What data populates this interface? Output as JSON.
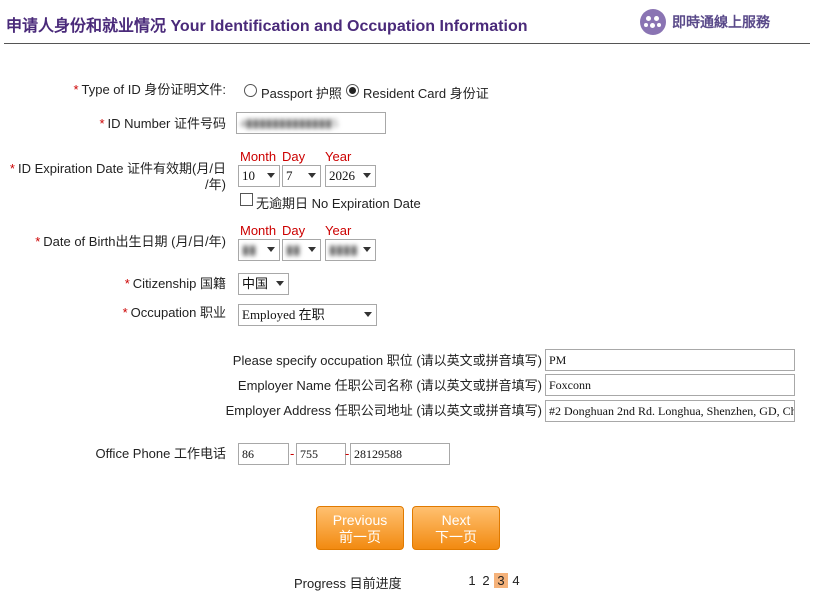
{
  "header": {
    "title": "申请人身份和就业情况 Your Identification and Occupation Information",
    "live_service": "即時通線上服務",
    "icon": "chat-bubble-icon"
  },
  "form": {
    "required_mark": "*",
    "id_type": {
      "label": "Type of ID 身份证明文件:",
      "options": [
        {
          "label": "Passport 护照",
          "selected": false
        },
        {
          "label": "Resident Card 身份证",
          "selected": true
        }
      ]
    },
    "id_number": {
      "label": "ID Number 证件号码",
      "value": "4▮▮▮▮▮▮▮▮▮▮▮▮▮5"
    },
    "expiration": {
      "label_line1": "ID Expiration Date 证件有效期(月/日",
      "label_line2": "/年)",
      "month_header": "Month",
      "day_header": "Day",
      "year_header": "Year",
      "month": "10",
      "day": "7",
      "year": "2026",
      "no_expiry_label": "无逾期日 No Expiration Date",
      "no_expiry_checked": false
    },
    "dob": {
      "label": "Date of Birth出生日期 (月/日/年)",
      "month_header": "Month",
      "day_header": "Day",
      "year_header": "Year",
      "month": "▮▮",
      "day": "▮▮",
      "year": "▮▮▮▮"
    },
    "citizenship": {
      "label": "Citizenship 国籍",
      "value": "中国"
    },
    "occupation": {
      "label": "Occupation 职业",
      "value": "Employed 在职"
    },
    "specify_occupation": {
      "label": "Please specify occupation 职位 (请以英文或拼音填写)",
      "value": "PM"
    },
    "employer_name": {
      "label": "Employer Name 任职公司名称 (请以英文或拼音填写)",
      "value": "Foxconn"
    },
    "employer_address": {
      "label": "Employer Address 任职公司地址 (请以英文或拼音填写)",
      "value": "#2 Donghuan 2nd Rd. Longhua, Shenzhen, GD, Ch"
    },
    "office_phone": {
      "label": "Office Phone 工作电话",
      "country": "86",
      "area": "755",
      "number": "28129588",
      "separator": "-"
    }
  },
  "nav": {
    "previous_en": "Previous",
    "previous_zh": "前一页",
    "next_en": "Next",
    "next_zh": "下一页"
  },
  "progress": {
    "label": "Progress 目前进度",
    "steps": [
      "1",
      "2",
      "3",
      "4"
    ],
    "current": 3
  },
  "colors": {
    "title": "#4a2a7a",
    "required": "#cc0000",
    "button": "#f28a10",
    "current_step": "#f5b27a"
  }
}
